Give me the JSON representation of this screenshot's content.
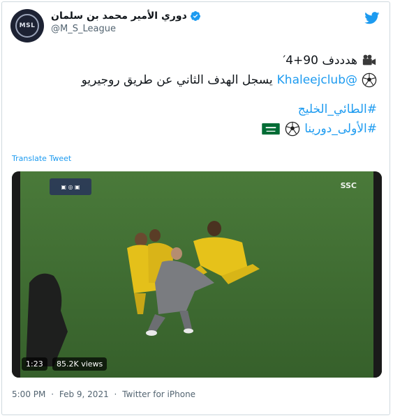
{
  "author": {
    "display_name": "دوري الأمير محمد بن سلمان",
    "handle": "@M_S_League",
    "avatar_text": "MSL"
  },
  "tweet": {
    "line1_text": "هدددف 90+4′",
    "line2_text": "يسجل الهدف الثاني عن طريق روجيريو",
    "line2_mention": "@Khaleejclub",
    "hashtag1": "#الطائي_الخليج",
    "hashtag2": "#الأولى_دورينا"
  },
  "translate_label": "Translate Tweet",
  "video": {
    "duration": "1:23",
    "views": "85.2K views",
    "overlay_right": "SSC"
  },
  "meta": {
    "time": "5:00 PM",
    "separator": "·",
    "date": "Feb 9, 2021",
    "source": "Twitter for iPhone"
  },
  "colors": {
    "link": "#1d9bf0",
    "pitch": "#3f6a31",
    "kit": "#e6c21a"
  }
}
